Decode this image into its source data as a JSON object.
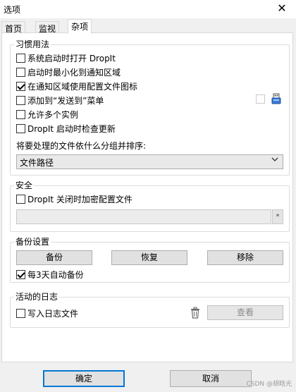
{
  "window": {
    "title": "选项",
    "close_glyph": "✕"
  },
  "tabs": [
    {
      "label": "首页",
      "active": false
    },
    {
      "label": "监视",
      "active": false
    },
    {
      "label": "杂项",
      "active": true
    }
  ],
  "habits": {
    "legend": "习惯用法",
    "options": [
      {
        "label": "系统启动时打开 DropIt",
        "checked": false
      },
      {
        "label": "启动时最小化到通知区域",
        "checked": false
      },
      {
        "label": "在通知区域使用配置文件图标",
        "checked": true
      },
      {
        "label": "添加到“发送到”菜单",
        "checked": false
      },
      {
        "label": "允许多个实例",
        "checked": false
      },
      {
        "label": "DropIt 启动时检查更新",
        "checked": false
      }
    ],
    "sort_label": "将要处理的文件依什么分组并排序:",
    "sort_value": "文件路径"
  },
  "security": {
    "legend": "安全",
    "encrypt_label": "DropIt 关闭时加密配置文件",
    "encrypt_checked": false,
    "password_value": "",
    "reveal_glyph": "*"
  },
  "backup": {
    "legend": "备份设置",
    "backup_label": "备份",
    "restore_label": "恢复",
    "remove_label": "移除",
    "auto_label": "每3天自动备份",
    "auto_checked": true
  },
  "log": {
    "legend": "活动的日志",
    "write_label": "写入日志文件",
    "write_checked": false,
    "view_label": "查看"
  },
  "footer": {
    "ok_label": "确定",
    "cancel_label": "取消",
    "watermark": "CSDN @胡晗光"
  }
}
